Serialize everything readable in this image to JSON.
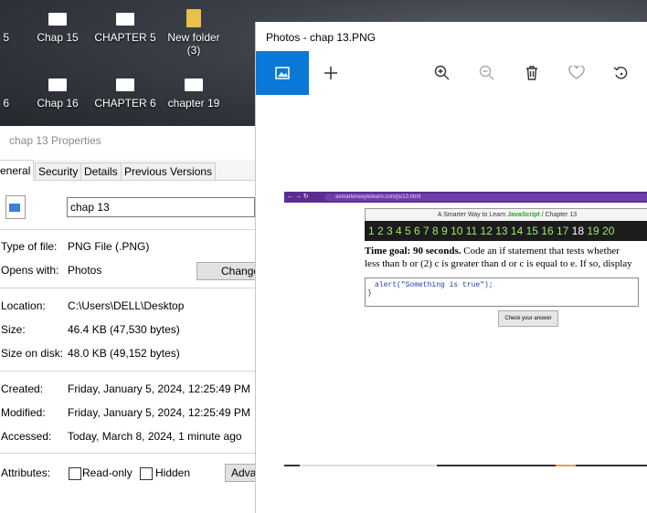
{
  "desktop": {
    "icons": [
      {
        "label": "5"
      },
      {
        "label": "Chap 15"
      },
      {
        "label": "CHAPTER 5"
      },
      {
        "label": "New folder\n(3)"
      },
      {
        "label": "6"
      },
      {
        "label": "Chap 16"
      },
      {
        "label": "CHAPTER 6"
      },
      {
        "label": "chapter 19"
      }
    ]
  },
  "properties": {
    "title": "chap 13 Properties",
    "tabs": [
      "eneral",
      "Security",
      "Details",
      "Previous Versions"
    ],
    "file_name": "chap 13",
    "type_label": "Type of file:",
    "type_value": "PNG File (.PNG)",
    "opens_label": "Opens with:",
    "opens_value": "Photos",
    "change_label": "Change",
    "location_label": "Location:",
    "location_value": "C:\\Users\\DELL\\Desktop",
    "size_label": "Size:",
    "size_value": "46.4 KB (47,530 bytes)",
    "disk_label": "Size on disk:",
    "disk_value": "48.0 KB (49,152 bytes)",
    "created_label": "Created:",
    "created_value": "Friday, January 5, 2024, 12:25:49 PM",
    "modified_label": "Modified:",
    "modified_value": "Friday, January 5, 2024, 12:25:49 PM",
    "accessed_label": "Accessed:",
    "accessed_value": "Today, March 8, 2024, 1 minute ago",
    "attributes_label": "Attributes:",
    "readonly_label": "Read-only",
    "hidden_label": "Hidden",
    "advanced_label": "Adva"
  },
  "photos": {
    "title": "Photos - chap 13.PNG",
    "image": {
      "url": "asmarterwaytolearn.com/js/13.html",
      "header_prefix": "A Smarter Way to Learn ",
      "header_brand": "JavaScript",
      "header_suffix": " / Chapter 13",
      "numbers_before": "1 2 3 4 5 6 7 8 9 10 11 12 13 14 15 16 17 ",
      "numbers_current": "18",
      "numbers_after": " 19 20",
      "goal_bold": "Time goal: 90 seconds.",
      "goal_rest": " Code an if statement that tests whether",
      "goal_line2": "less than b or (2) c is greater than d or c is equal to e. If so, display",
      "code": "alert(\"Something is true\");",
      "code_close": "}",
      "check_label": "Check your answer"
    }
  },
  "colors": {
    "accent": "#0a78d7",
    "browser_bar": "#5b2d91",
    "number_green": "#9fe870"
  }
}
